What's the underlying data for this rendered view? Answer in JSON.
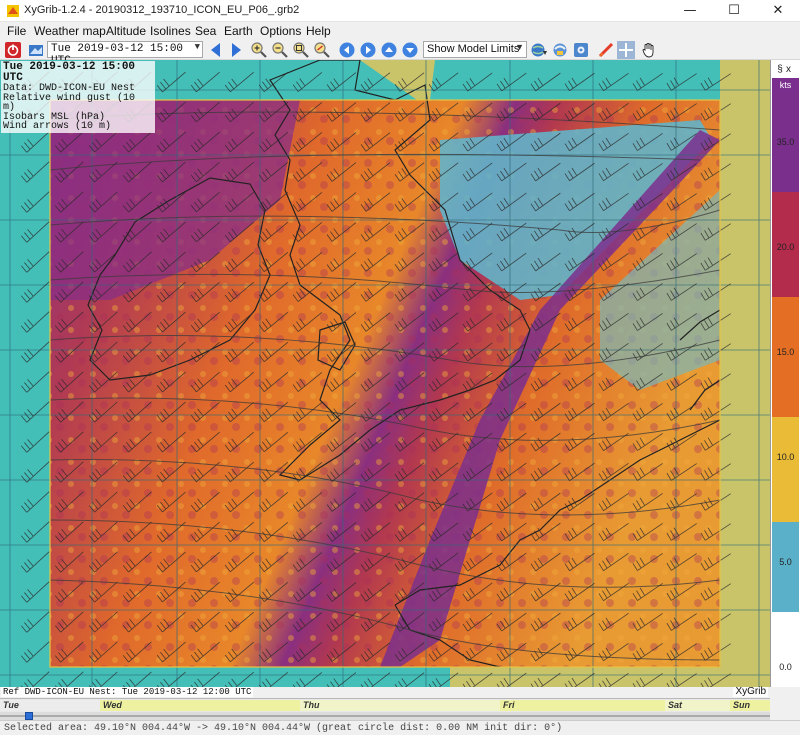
{
  "window": {
    "title": "XyGrib-1.2.4 - 20190312_193710_ICON_EU_P06_.grb2",
    "minimize_glyph": "—",
    "maximize_glyph": "☐",
    "close_glyph": "✕"
  },
  "menu": [
    "File",
    "Weather map",
    "Altitude",
    "Isolines",
    "Sea",
    "Earth",
    "Options",
    "Help"
  ],
  "toolbar": {
    "date_select": "Tue 2019-03-12 15:00 UTC",
    "model_limits_select": "Show Model Limits",
    "icons": [
      "power-icon",
      "open-file-icon",
      "prev-arrow-icon",
      "next-arrow-icon",
      "zoom-in-icon",
      "zoom-out-icon",
      "zoom-fit-icon",
      "zoom-area-icon",
      "nav-left-icon",
      "nav-right-icon",
      "nav-up-icon",
      "nav-down-icon",
      "globe-download-icon",
      "meteotable-icon",
      "settings-icon",
      "rocket-icon",
      "crosshair-icon",
      "hand-icon"
    ]
  },
  "map": {
    "info": {
      "date": "Tue 2019-03-12 15:00 UTC",
      "data": "Data: DWD-ICON-EU Nest",
      "layer": "Relative wind gust (10 m)",
      "isobars": "Isobars MSL (hPa)",
      "arrows": "Wind arrows (10 m)"
    },
    "ref_label": "Ref DWD-ICON-EU Nest: Tue 2019-03-12 12:00 UTC",
    "brand": "XyGrib",
    "sea_color": "#44bfb8",
    "land_color": "#c9c46a"
  },
  "scale": {
    "unit_symbol": "§",
    "close_glyph": "x",
    "units": "kts",
    "bands": [
      {
        "label": "35.0",
        "color": "#7b2f8d"
      },
      {
        "label": "20.0",
        "color": "#b32c4c"
      },
      {
        "label": "15.0",
        "color": "#e46e23"
      },
      {
        "label": "10.0",
        "color": "#eabb36"
      },
      {
        "label": "5.0",
        "color": "#5ab0c9"
      },
      {
        "label": "0.0",
        "color": "#ffffff"
      }
    ]
  },
  "timeline": {
    "days": [
      "Tue",
      "Wed",
      "Thu",
      "Fri",
      "Sat",
      "Sun"
    ]
  },
  "status": {
    "message": "Selected area: 49.10°N 004.44°W -> 49.10°N 004.44°W   (great circle dist: 0.00 NM  init dir: 0°)"
  }
}
